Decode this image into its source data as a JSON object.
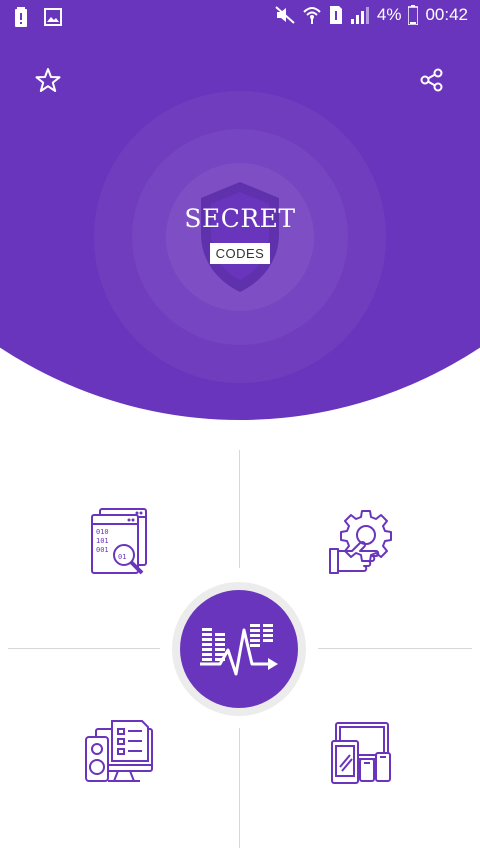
{
  "status_bar": {
    "battery_percent": "4%",
    "time": "00:42"
  },
  "header": {
    "logo_title": "SECRET",
    "logo_badge": "CODES",
    "star_icon": "star-outline-icon",
    "share_icon": "share-icon"
  },
  "features": [
    {
      "icon": "code-search-icon"
    },
    {
      "icon": "gear-hand-icon"
    },
    {
      "icon": "device-info-icon"
    },
    {
      "icon": "devices-icon"
    }
  ],
  "center": {
    "icon": "signal-analyzer-icon"
  },
  "colors": {
    "primary": "#6a35bd",
    "white": "#ffffff",
    "divider": "#d8d8d8"
  }
}
